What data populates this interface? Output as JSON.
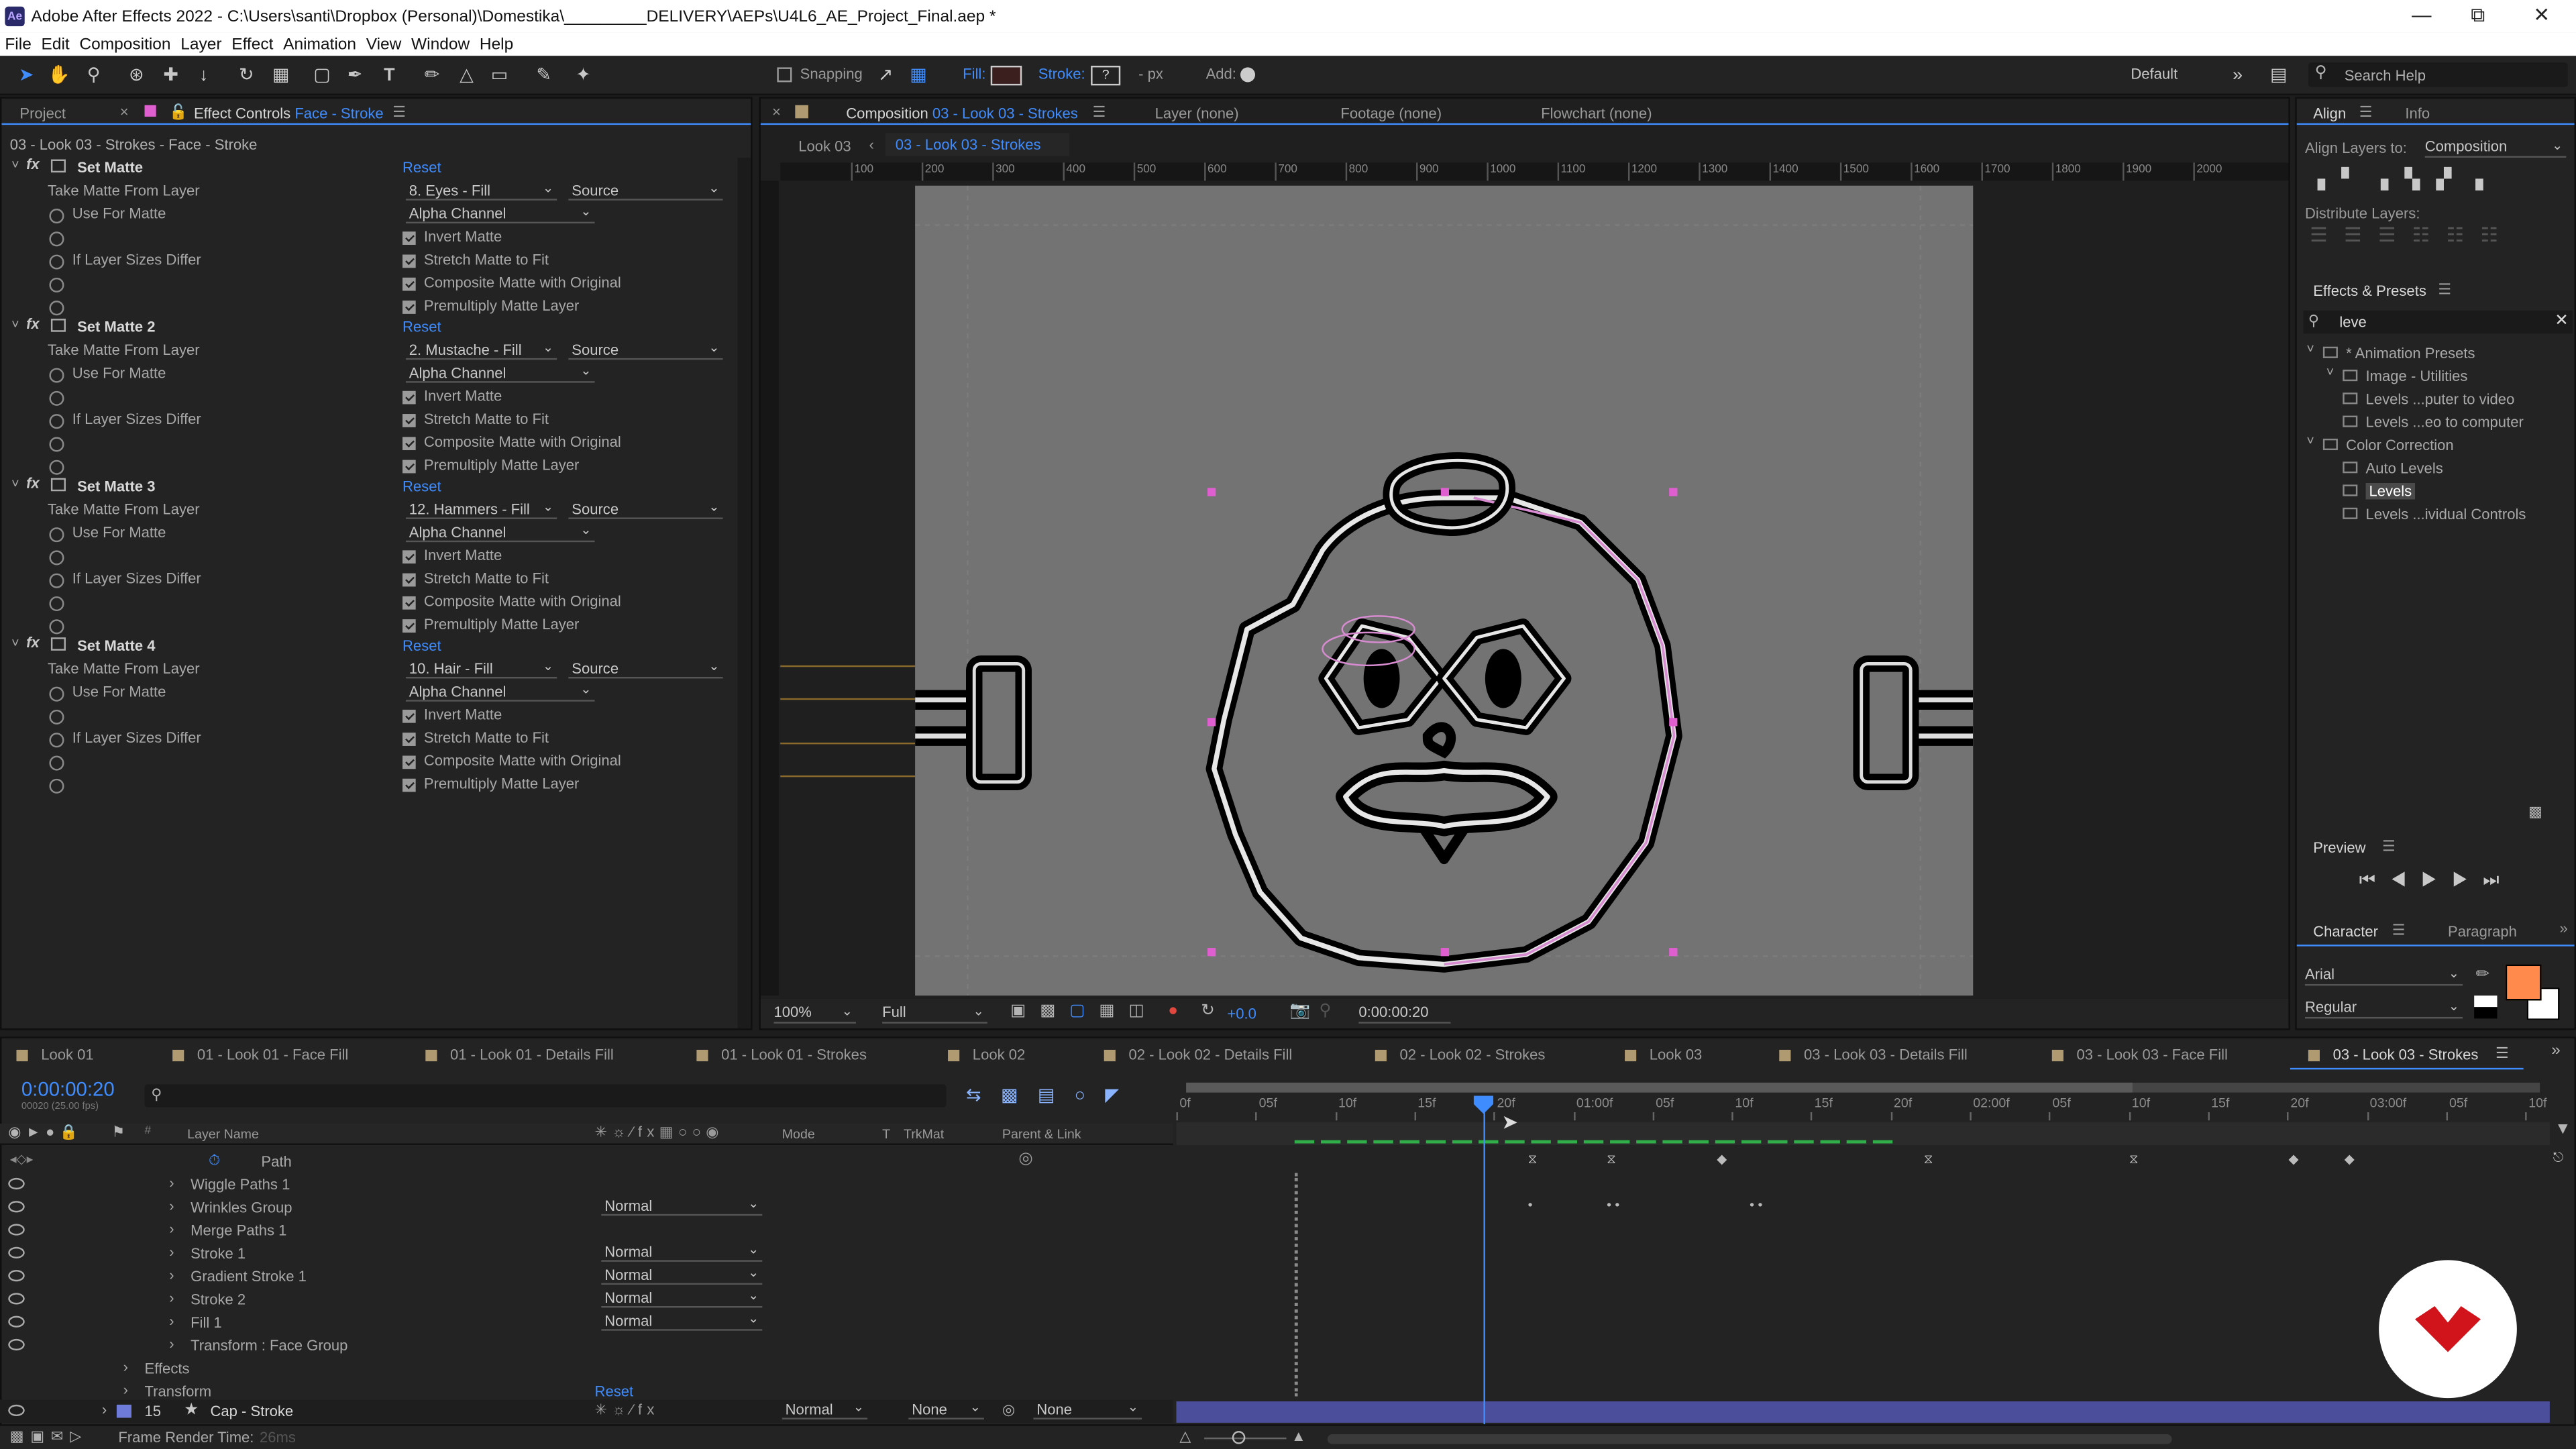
{
  "title_bar": {
    "app_logo": "Ae",
    "text": "Adobe After Effects 2022 - C:\\Users\\santi\\Dropbox (Personal)\\Domestika\\_________DELIVERY\\AEPs\\U4L6_AE_Project_Final.aep *"
  },
  "menu": [
    "File",
    "Edit",
    "Composition",
    "Layer",
    "Effect",
    "Animation",
    "View",
    "Window",
    "Help"
  ],
  "toolbar": {
    "snapping": "Snapping",
    "fill": "Fill:",
    "stroke": "Stroke:",
    "stroke_value": "?",
    "px": "- px",
    "add": "Add:",
    "workspace": "Default",
    "search_help": "Search Help"
  },
  "left_panel": {
    "tab_project": "Project",
    "tab_effect_controls": "Effect Controls",
    "tab_effect_layer": "Face - Stroke",
    "subheader": "03 - Look 03 - Strokes - Face - Stroke",
    "effects": [
      {
        "name": "Set Matte",
        "reset": "Reset",
        "take_label": "Take Matte From Layer",
        "layer": "8. Eyes - Fill",
        "source": "Source",
        "use_label": "Use For Matte",
        "use": "Alpha Channel",
        "invert": "Invert Matte",
        "sizes_label": "If Layer Sizes Differ",
        "stretch": "Stretch Matte to Fit",
        "composite": "Composite Matte with Original",
        "premultiply": "Premultiply Matte Layer"
      },
      {
        "name": "Set Matte 2",
        "reset": "Reset",
        "take_label": "Take Matte From Layer",
        "layer": "2. Mustache - Fill",
        "source": "Source",
        "use_label": "Use For Matte",
        "use": "Alpha Channel",
        "invert": "Invert Matte",
        "sizes_label": "If Layer Sizes Differ",
        "stretch": "Stretch Matte to Fit",
        "composite": "Composite Matte with Original",
        "premultiply": "Premultiply Matte Layer"
      },
      {
        "name": "Set Matte 3",
        "reset": "Reset",
        "take_label": "Take Matte From Layer",
        "layer": "12. Hammers - Fill",
        "source": "Source",
        "use_label": "Use For Matte",
        "use": "Alpha Channel",
        "invert": "Invert Matte",
        "sizes_label": "If Layer Sizes Differ",
        "stretch": "Stretch Matte to Fit",
        "composite": "Composite Matte with Original",
        "premultiply": "Premultiply Matte Layer"
      },
      {
        "name": "Set Matte 4",
        "reset": "Reset",
        "take_label": "Take Matte From Layer",
        "layer": "10. Hair - Fill",
        "source": "Source",
        "use_label": "Use For Matte",
        "use": "Alpha Channel",
        "invert": "Invert Matte",
        "sizes_label": "If Layer Sizes Differ",
        "stretch": "Stretch Matte to Fit",
        "composite": "Composite Matte with Original",
        "premultiply": "Premultiply Matte Layer"
      }
    ]
  },
  "comp_panel": {
    "tab_label": "Composition",
    "tab_comp": "03 - Look 03 - Strokes",
    "tab_layer": "Layer  (none)",
    "tab_footage": "Footage  (none)",
    "tab_flowchart": "Flowchart  (none)",
    "crumb_parent": "Look 03",
    "crumb_current": "03 - Look 03 - Strokes",
    "ruler_ticks": [
      "100",
      "200",
      "300",
      "400",
      "500",
      "600",
      "700",
      "800",
      "900",
      "1000",
      "1100",
      "1200",
      "1300",
      "1400",
      "1500",
      "1600",
      "1700",
      "1800",
      "1900",
      "2000"
    ],
    "zoom": "100%",
    "resolution": "Full",
    "exposure": "+0.0",
    "timecode": "0:00:00:20"
  },
  "right_panel": {
    "tab_align": "Align",
    "tab_info": "Info",
    "align_layers_to": "Align Layers to:",
    "align_target": "Composition",
    "distribute_layers": "Distribute Layers:",
    "effects_presets": "Effects & Presets",
    "search_value": "leve",
    "tree": [
      {
        "label": "* Animation Presets",
        "level": 0
      },
      {
        "label": "Image - Utilities",
        "level": 1
      },
      {
        "label": "Levels ...puter to video",
        "level": 2
      },
      {
        "label": "Levels ...eo to computer",
        "level": 2
      },
      {
        "label": "Color Correction",
        "level": 0
      },
      {
        "label": "Auto Levels",
        "level": 2
      },
      {
        "label": "Levels",
        "level": 2
      },
      {
        "label": "Levels ...ividual Controls",
        "level": 2
      }
    ],
    "preview": "Preview",
    "tab_character": "Character",
    "tab_paragraph": "Paragraph",
    "font": "Arial",
    "font_style": "Regular",
    "fill_color": "#ff8a4c"
  },
  "timeline": {
    "tabs": [
      "Look 01",
      "01 - Look 01 - Face Fill",
      "01 - Look 01 - Details Fill",
      "01 - Look 01 - Strokes",
      "Look 02",
      "02 - Look 02 - Details Fill",
      "02 - Look 02 - Strokes",
      "Look 03",
      "03 - Look 03 - Details Fill",
      "03 - Look 03 - Face Fill",
      "03 - Look 03 - Strokes"
    ],
    "timecode": "0:00:00:20",
    "fps": "00020 (25.00 fps)",
    "col_layer_name": "Layer Name",
    "col_mode": "Mode",
    "col_t": "T",
    "col_trkmat": "TrkMat",
    "col_parent": "Parent & Link",
    "ticks": [
      "0f",
      "05f",
      "10f",
      "15f",
      "20f",
      "01:00f",
      "05f",
      "10f",
      "15f",
      "20f",
      "02:00f",
      "05f",
      "10f",
      "15f",
      "20f",
      "03:00f",
      "05f",
      "10f"
    ],
    "rows": [
      {
        "name": "Path",
        "mode": ""
      },
      {
        "name": "Wiggle Paths 1",
        "mode": ""
      },
      {
        "name": "Wrinkles Group",
        "mode": "Normal"
      },
      {
        "name": "Merge Paths 1",
        "mode": ""
      },
      {
        "name": "Stroke 1",
        "mode": "Normal"
      },
      {
        "name": "Gradient Stroke 1",
        "mode": "Normal"
      },
      {
        "name": "Stroke 2",
        "mode": "Normal"
      },
      {
        "name": "Fill 1",
        "mode": "Normal"
      },
      {
        "name": "Transform : Face Group",
        "mode": ""
      },
      {
        "name": "Effects",
        "mode": ""
      },
      {
        "name": "Transform",
        "mode": "",
        "reset": "Reset"
      }
    ],
    "layer15": {
      "num": "15",
      "name": "Cap - Stroke",
      "mode": "Normal",
      "trkmat": "None",
      "parent": "None"
    },
    "render_time_label": "Frame Render Time:",
    "render_time": "26ms"
  }
}
